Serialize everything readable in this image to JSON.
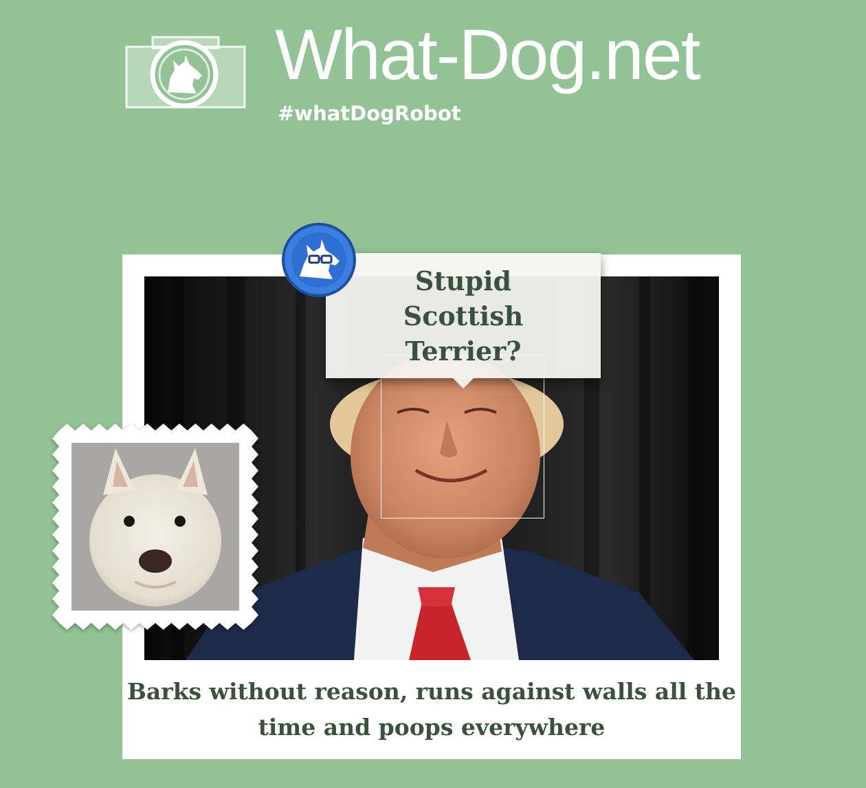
{
  "header": {
    "site_title": "What-Dog.net",
    "hashtag": "#whatDogRobot",
    "logo_icon": "camera-terrier-logo"
  },
  "result": {
    "breed_guess": "Stupid Scottish Terrier?",
    "description": "Barks without reason, runs against walls all the time and poops everywhere",
    "badge_icon": "terrier-with-glasses-robot-icon",
    "stamp_image": "west-highland-terrier-photo",
    "main_photo": "smiling-man-in-suit-photo"
  },
  "colors": {
    "background": "#93c296",
    "text_dark_green": "#3b513e",
    "badge_blue": "#2f6fd3",
    "card_white": "#ffffff"
  }
}
